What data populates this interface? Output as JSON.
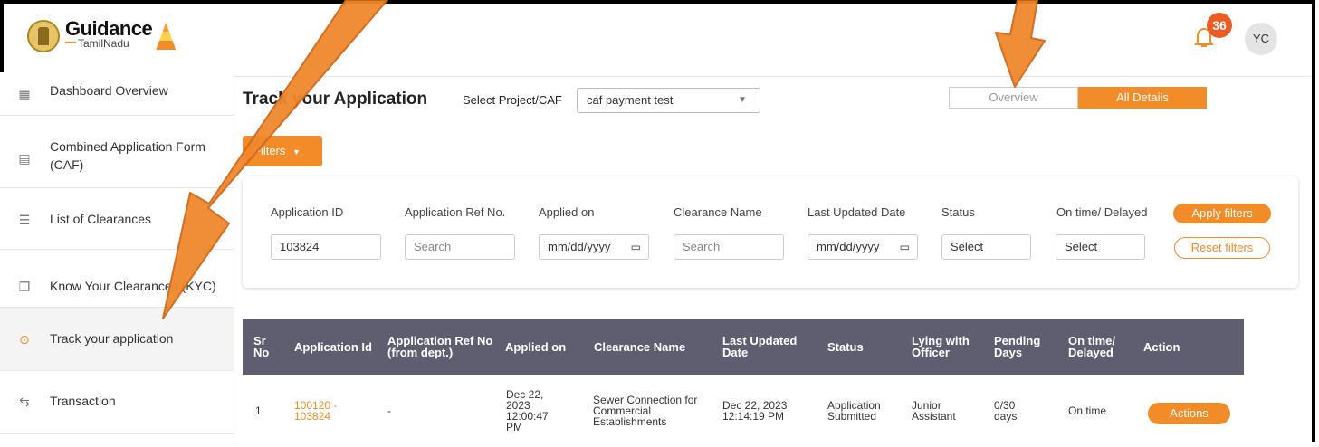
{
  "header": {
    "logo_title": "Guidance",
    "logo_subtitle": "TamilNadu",
    "notification_count": "36",
    "avatar_initials": "YC"
  },
  "sidebar": {
    "items": [
      {
        "label": "Dashboard Overview",
        "icon": "dashboard-icon"
      },
      {
        "label": "Combined Application Form (CAF)",
        "icon": "document-icon"
      },
      {
        "label": "List of Clearances",
        "icon": "list-icon"
      },
      {
        "label": "Know Your Clearances (KYC)",
        "icon": "book-icon"
      },
      {
        "label": "Track your application",
        "icon": "location-pin-icon"
      },
      {
        "label": "Transaction",
        "icon": "transaction-icon"
      }
    ]
  },
  "main": {
    "title": "Track your Application",
    "select_project_label": "Select Project/CAF",
    "select_project_value": "caf payment test",
    "toggle_overview": "Overview",
    "toggle_all_details": "All Details",
    "filters_button": "Filters"
  },
  "filters": {
    "labels": [
      "Application ID",
      "Application Ref No.",
      "Applied on",
      "Clearance Name",
      "Last Updated Date",
      "Status",
      "On time/ Delayed"
    ],
    "application_id_value": "103824",
    "ref_no_placeholder": "Search",
    "applied_on_placeholder": "mm/dd/yyyy",
    "clearance_name_placeholder": "Search",
    "last_updated_placeholder": "mm/dd/yyyy",
    "status_value": "Select",
    "ontime_value": "Select",
    "apply_button": "Apply filters",
    "reset_button": "Reset filters"
  },
  "table": {
    "headers": [
      "Sr No",
      "Application Id",
      "Application Ref No (from dept.)",
      "Applied on",
      "Clearance Name",
      "Last Updated Date",
      "Status",
      "Lying with Officer",
      "Pending Days",
      "On time/ Delayed",
      "Action"
    ],
    "rows": [
      {
        "sr": "1",
        "app_id": "100120 - 103824",
        "ref_no": "-",
        "applied_on": "Dec 22, 2023 12:00:47 PM",
        "clearance_name": "Sewer Connection for Commercial Establishments",
        "last_updated": "Dec 22, 2023 12:14:19 PM",
        "status": "Application Submitted",
        "officer": "Junior Assistant",
        "pending_days": "0/30 days",
        "ontime": "On time",
        "action": "Actions"
      }
    ]
  },
  "colors": {
    "accent": "#f28c28",
    "table_header": "#5e5e70",
    "badge": "#ee5a24"
  }
}
